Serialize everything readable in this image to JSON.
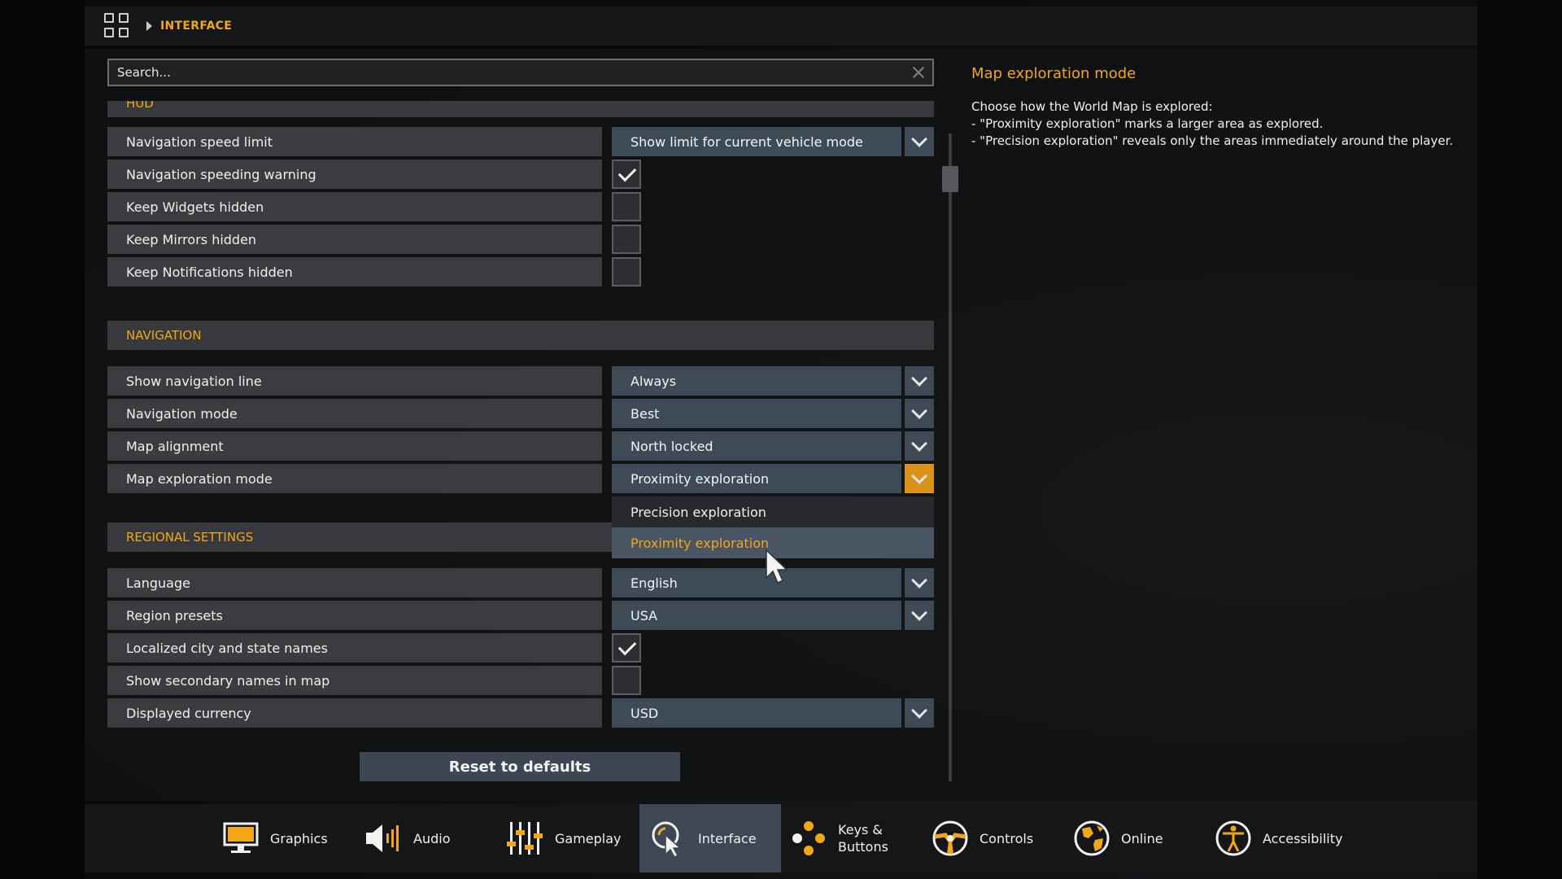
{
  "header": {
    "breadcrumb": "INTERFACE"
  },
  "search": {
    "placeholder": "Search..."
  },
  "sections": {
    "hud": "HUD",
    "navigation": "NAVIGATION",
    "regional": "REGIONAL SETTINGS"
  },
  "hud_rows": [
    {
      "label": "Navigation speed limit",
      "value": "Show limit for current vehicle mode"
    },
    {
      "label": "Navigation speeding warning",
      "checked": true
    },
    {
      "label": "Keep Widgets hidden",
      "checked": false
    },
    {
      "label": "Keep Mirrors hidden",
      "checked": false
    },
    {
      "label": "Keep Notifications hidden",
      "checked": false
    }
  ],
  "nav_rows": [
    {
      "label": "Show navigation line",
      "value": "Always"
    },
    {
      "label": "Navigation mode",
      "value": "Best"
    },
    {
      "label": "Map alignment",
      "value": "North locked"
    },
    {
      "label": "Map exploration mode",
      "value": "Proximity exploration"
    }
  ],
  "dropdown_options": [
    "Precision exploration",
    "Proximity exploration"
  ],
  "regional_rows": [
    {
      "label": "Language",
      "value": "English"
    },
    {
      "label": "Region presets",
      "value": "USA"
    },
    {
      "label": "Localized city and state names",
      "checked": true
    },
    {
      "label": "Show secondary names in map",
      "checked": false
    },
    {
      "label": "Displayed currency",
      "value": "USD"
    }
  ],
  "reset_label": "Reset to defaults",
  "description": {
    "title": "Map exploration mode",
    "lines": [
      "Choose how the World Map is explored:",
      "- \"Proximity exploration\" marks a larger area as explored.",
      "- \"Precision exploration\" reveals only the areas immediately around the player."
    ]
  },
  "bottom_tabs": [
    {
      "label": "Graphics",
      "icon": "monitor-icon"
    },
    {
      "label": "Audio",
      "icon": "speaker-icon"
    },
    {
      "label": "Gameplay",
      "icon": "sliders-icon"
    },
    {
      "label": "Interface",
      "icon": "cursor-icon",
      "active": true
    },
    {
      "label": "Keys &",
      "label2": "Buttons",
      "icon": "dots-icon"
    },
    {
      "label": "Controls",
      "icon": "steering-wheel-icon"
    },
    {
      "label": "Online",
      "icon": "globe-icon"
    },
    {
      "label": "Accessibility",
      "icon": "accessibility-icon"
    }
  ],
  "colors": {
    "accent": "#f2a719",
    "dropdown_bg": "#3f4a57",
    "active_tab": "#3e4754"
  }
}
